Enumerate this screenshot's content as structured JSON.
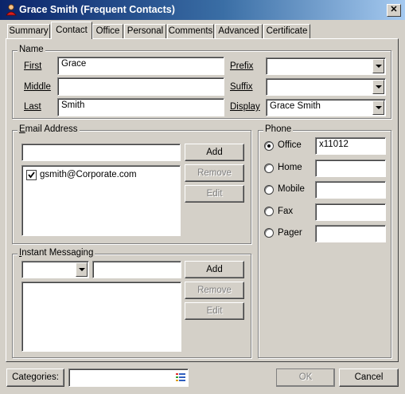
{
  "window": {
    "title": "Grace Smith (Frequent Contacts)",
    "close_label": "✕"
  },
  "tabs": [
    "Summary",
    "Contact",
    "Office",
    "Personal",
    "Comments",
    "Advanced",
    "Certificate"
  ],
  "active_tab": "Contact",
  "name_group": {
    "legend": "Name",
    "first_label": "First",
    "first_value": "Grace",
    "middle_label": "Middle",
    "middle_value": "",
    "last_label": "Last",
    "last_value": "Smith",
    "prefix_label": "Prefix",
    "prefix_value": "",
    "suffix_label": "Suffix",
    "suffix_value": "",
    "display_label": "Display",
    "display_value": "Grace Smith"
  },
  "email_group": {
    "legend": "Email Address",
    "input_value": "",
    "add_label": "Add",
    "remove_label": "Remove",
    "edit_label": "Edit",
    "entries": [
      {
        "address": "gsmith@Corporate.com",
        "checked": true
      }
    ]
  },
  "im_group": {
    "legend": "Instant Messaging",
    "service_value": "",
    "address_value": "",
    "add_label": "Add",
    "remove_label": "Remove",
    "edit_label": "Edit"
  },
  "phone_group": {
    "legend": "Phone",
    "selected": "Office",
    "rows": [
      {
        "label": "Office",
        "value": "x11012"
      },
      {
        "label": "Home",
        "value": ""
      },
      {
        "label": "Mobile",
        "value": ""
      },
      {
        "label": "Fax",
        "value": ""
      },
      {
        "label": "Pager",
        "value": ""
      }
    ]
  },
  "footer": {
    "categories_label": "Categories:",
    "categories_value": "",
    "ok_label": "OK",
    "cancel_label": "Cancel"
  },
  "icons": {
    "title_icon": "contact-person-icon",
    "categories_icon": "list-icon"
  }
}
